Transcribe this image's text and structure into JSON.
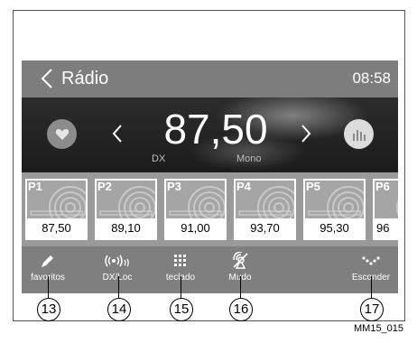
{
  "header": {
    "title": "Rádio",
    "time": "08:58"
  },
  "tuner": {
    "frequency": "87,50",
    "band_mode": "DX",
    "audio_mode": "Mono"
  },
  "presets": [
    {
      "label": "P1",
      "frequency": "87,50"
    },
    {
      "label": "P2",
      "frequency": "89,10"
    },
    {
      "label": "P3",
      "frequency": "91,00"
    },
    {
      "label": "P4",
      "frequency": "93,70"
    },
    {
      "label": "P5",
      "frequency": "95,30"
    },
    {
      "label": "P6",
      "frequency": "96"
    }
  ],
  "toolbar": {
    "favorites": "favoritos",
    "dxloc": "DX/Loc",
    "keypad": "teclado",
    "mute": "Mudo",
    "hide": "Esconder"
  },
  "callouts": [
    "13",
    "14",
    "15",
    "16",
    "17"
  ],
  "figure_ref": "MM15_015",
  "icons": {
    "back": "chevron-left-icon",
    "favorite": "heart-icon",
    "prev": "chevron-left-icon",
    "next": "chevron-right-icon",
    "equalizer": "equalizer-icon",
    "favorites_tool": "pencil-icon",
    "dxloc_tool": "antenna-signal-icon",
    "keypad_tool": "keypad-icon",
    "mute_tool": "mute-icon",
    "hide_tool": "dots-down-icon"
  }
}
